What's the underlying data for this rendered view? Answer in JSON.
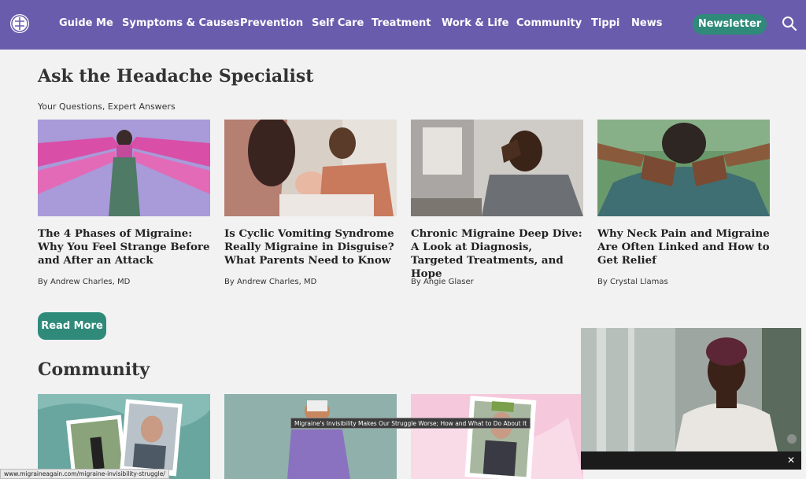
{
  "nav": {
    "items": [
      "Guide Me",
      "Symptoms & Causes",
      "Prevention",
      "Self Care",
      "Treatment",
      "Work & Life",
      "Community",
      "Tippi",
      "News"
    ],
    "newsletter_label": "Newsletter"
  },
  "specialist": {
    "heading": "Ask the Headache Specialist",
    "subtitle": "Your Questions, Expert Answers",
    "cards": [
      {
        "title": "The 4 Phases of Migraine: Why You Feel Strange Before and After an Attack",
        "author": "By Andrew Charles, MD"
      },
      {
        "title": "Is Cyclic Vomiting Syndrome Really Migraine in Disguise? What Parents Need to Know",
        "author": "By Andrew Charles, MD"
      },
      {
        "title": "Chronic Migraine Deep Dive: A Look at Diagnosis, Targeted Treatments, and Hope",
        "author": "By Angie Glaser"
      },
      {
        "title": "Why Neck Pain and Migraine Are Often Linked and How to Get Relief",
        "author": "By Crystal Llamas"
      }
    ],
    "read_more_label": "Read More"
  },
  "community": {
    "heading": "Community"
  },
  "tooltip_text": "Migraine's Invisibility Makes Our Struggle Worse; How and What to Do About It",
  "status_url": "www.migraineagain.com/migraine-invisibility-struggle/",
  "colors": {
    "nav_bg": "#6a5cad",
    "accent_teal": "#2f8a7a",
    "page_bg": "#f2f2f2"
  }
}
